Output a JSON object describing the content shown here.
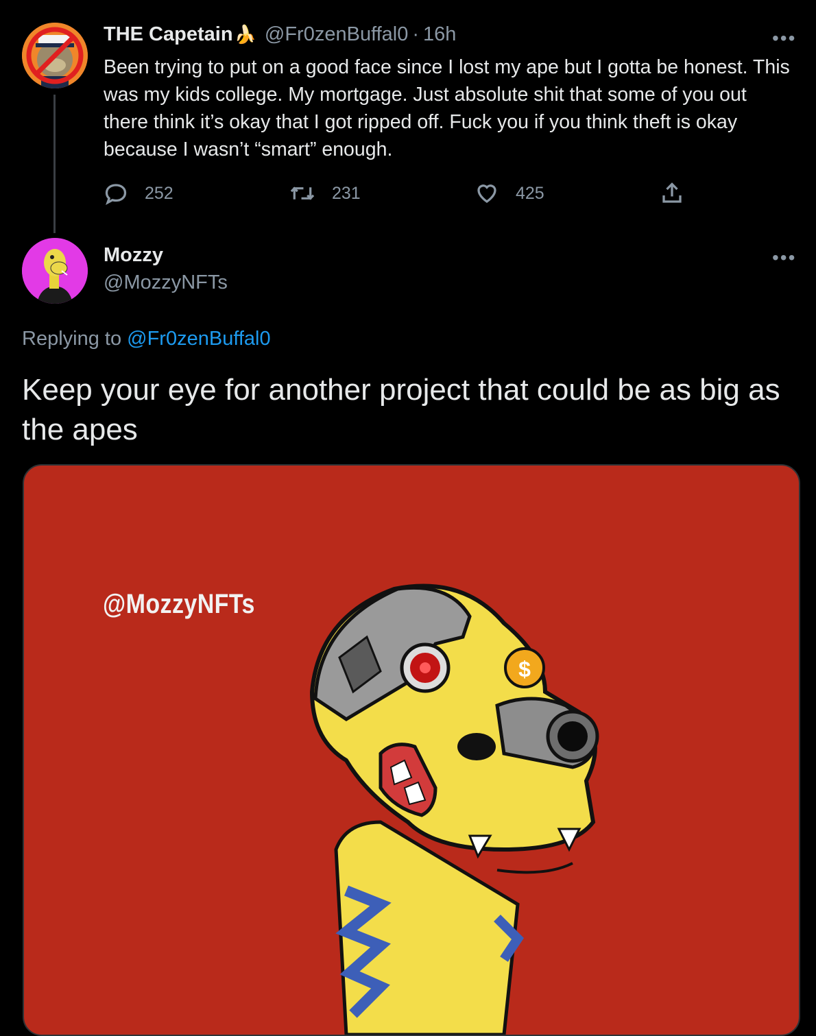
{
  "tweet1": {
    "display_name": "THE Capetain",
    "name_emoji": "🍌",
    "handle": "@Fr0zenBuffal0",
    "separator": "·",
    "time": "16h",
    "text": "Been trying to put on a good face since I lost my ape but I gotta be honest. This was my kids college. My mortgage. Just absolute shit that some of you out there think it’s okay that I got ripped off. Fuck you if you think theft is okay because I wasn’t “smart” enough.",
    "replies": "252",
    "retweets": "231",
    "likes": "425",
    "more_label": "•••"
  },
  "tweet2": {
    "display_name": "Mozzy",
    "handle": "@MozzyNFTs",
    "more_label": "•••",
    "replying_prefix": "Replying to ",
    "replying_to": "@Fr0zenBuffal0",
    "text": "Keep your eye for another project that could be as big as the apes",
    "media_watermark": "@MozzyNFTs"
  },
  "colors": {
    "background": "#000000",
    "text_primary": "#e7e9ea",
    "text_secondary": "#8b98a5",
    "link": "#1d9bf0",
    "media_bg": "#b92a1b"
  },
  "icons": {
    "reply": "reply-icon",
    "retweet": "retweet-icon",
    "like": "heart-icon",
    "share": "share-icon",
    "more": "more-icon"
  }
}
